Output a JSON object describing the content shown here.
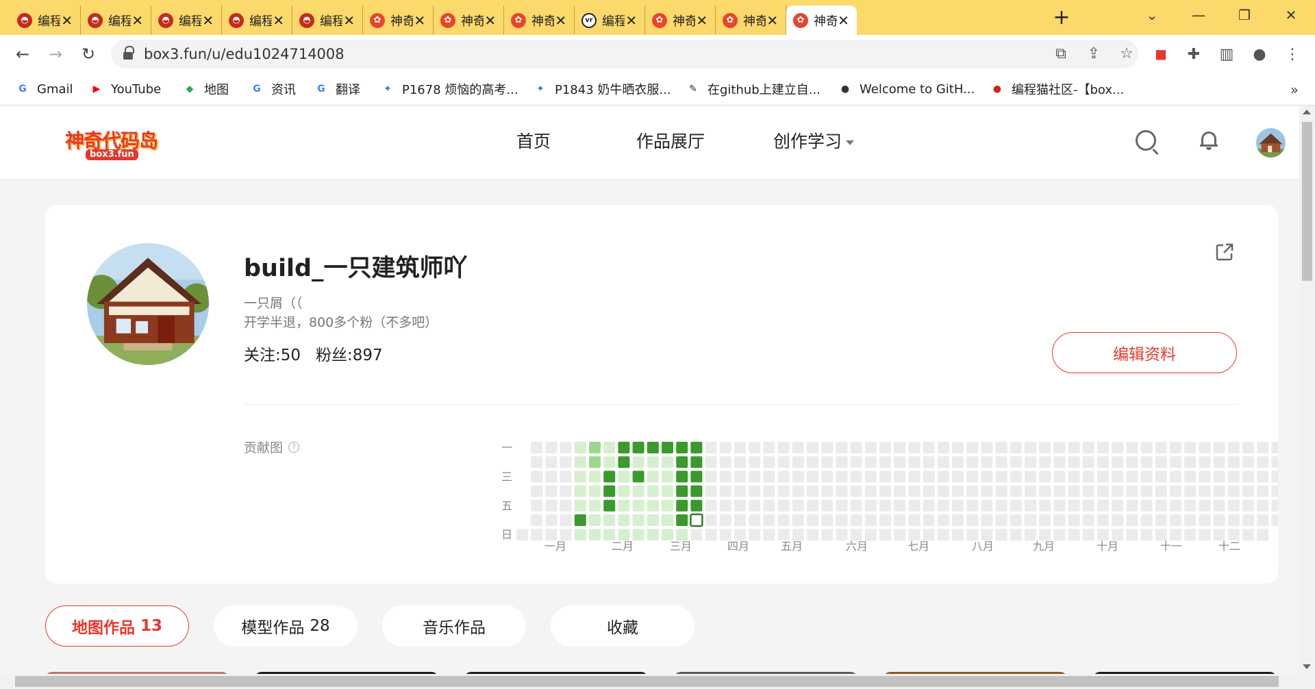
{
  "browser": {
    "tabs": [
      {
        "title": "编程",
        "favicon": "codemao"
      },
      {
        "title": "编程",
        "favicon": "codemao"
      },
      {
        "title": "编程",
        "favicon": "codemao"
      },
      {
        "title": "编程",
        "favicon": "codemao"
      },
      {
        "title": "编程",
        "favicon": "codemao"
      },
      {
        "title": "神奇",
        "favicon": "box3"
      },
      {
        "title": "神奇",
        "favicon": "box3"
      },
      {
        "title": "神奇",
        "favicon": "box3"
      },
      {
        "title": "编程",
        "favicon": "vr"
      },
      {
        "title": "神奇",
        "favicon": "box3"
      },
      {
        "title": "神奇",
        "favicon": "box3"
      },
      {
        "title": "神奇",
        "favicon": "box3",
        "active": true
      }
    ],
    "url": "box3.fun/u/edu1024714008",
    "bookmarks": [
      {
        "label": "Gmail",
        "icon": "G",
        "color": "#4285f4"
      },
      {
        "label": "YouTube",
        "icon": "▶",
        "color": "#ff0000"
      },
      {
        "label": "地图",
        "icon": "◆",
        "color": "#34a853"
      },
      {
        "label": "资讯",
        "icon": "G",
        "color": "#4285f4"
      },
      {
        "label": "翻译",
        "icon": "G",
        "color": "#4285f4"
      },
      {
        "label": "P1678 烦恼的高考...",
        "icon": "✦",
        "color": "#3a7bd5"
      },
      {
        "label": "P1843 奶牛晒衣服...",
        "icon": "✦",
        "color": "#3a7bd5"
      },
      {
        "label": "在github上建立自...",
        "icon": "✎",
        "color": "#333333"
      },
      {
        "label": "Welcome to GitH...",
        "icon": "●",
        "color": "#333333"
      },
      {
        "label": "编程猫社区-【box...",
        "icon": "●",
        "color": "#c62a1e"
      }
    ]
  },
  "site": {
    "logo_main": "神奇代码岛",
    "logo_sub": "box3.fun",
    "nav": [
      "首页",
      "作品展厅",
      "创作学习"
    ]
  },
  "profile": {
    "username": "build_一只建筑师吖",
    "bio_line1": "一只屑（（",
    "bio_line2": "开学半退，800多个粉（不多吧）",
    "follow": "关注:50",
    "fans": "粉丝:897",
    "edit_button": "编辑资料",
    "contrib_label": "贡献图"
  },
  "chart_data": {
    "type": "heatmap",
    "title": "",
    "row_labels": [
      "一",
      "",
      "三",
      "",
      "五",
      "",
      "日"
    ],
    "month_labels": [
      "一月",
      "二月",
      "三月",
      "四月",
      "五月",
      "六月",
      "七月",
      "八月",
      "九月",
      "十月",
      "十一",
      "十二"
    ],
    "weeks": 53,
    "levels_description": "0 = none, 1 = past-day light, 2 = medium, 3 = high, -1 = not yet",
    "values": [
      [
        -1,
        -1,
        -1,
        -1,
        -1,
        -1,
        0
      ],
      [
        0,
        0,
        0,
        0,
        0,
        0,
        0
      ],
      [
        0,
        0,
        0,
        0,
        0,
        0,
        0
      ],
      [
        0,
        0,
        0,
        0,
        0,
        0,
        0
      ],
      [
        1,
        1,
        1,
        1,
        1,
        3,
        1
      ],
      [
        2,
        2,
        1,
        1,
        1,
        1,
        1
      ],
      [
        1,
        1,
        3,
        3,
        3,
        1,
        1
      ],
      [
        3,
        3,
        1,
        1,
        1,
        1,
        1
      ],
      [
        3,
        1,
        3,
        1,
        1,
        1,
        1
      ],
      [
        3,
        1,
        1,
        1,
        1,
        1,
        1
      ],
      [
        3,
        1,
        1,
        1,
        1,
        1,
        1
      ],
      [
        3,
        3,
        3,
        3,
        3,
        3,
        1
      ],
      [
        3,
        3,
        3,
        3,
        3,
        4,
        0
      ],
      [
        0,
        0,
        0,
        0,
        0,
        0,
        0
      ]
    ],
    "colors": {
      "none": "#ebebeb",
      "light": "#d6efcf",
      "medium": "#9cd88b",
      "high": "#3a9a2c",
      "today_border": "#2f7a23"
    }
  },
  "works_tabs": [
    {
      "label": "地图作品",
      "count": "13",
      "active": true
    },
    {
      "label": "模型作品",
      "count": "28"
    },
    {
      "label": "音乐作品",
      "count": ""
    },
    {
      "label": "收藏",
      "count": ""
    }
  ],
  "colors": {
    "accent": "#e8372a",
    "tabbar": "#fbd96a"
  }
}
